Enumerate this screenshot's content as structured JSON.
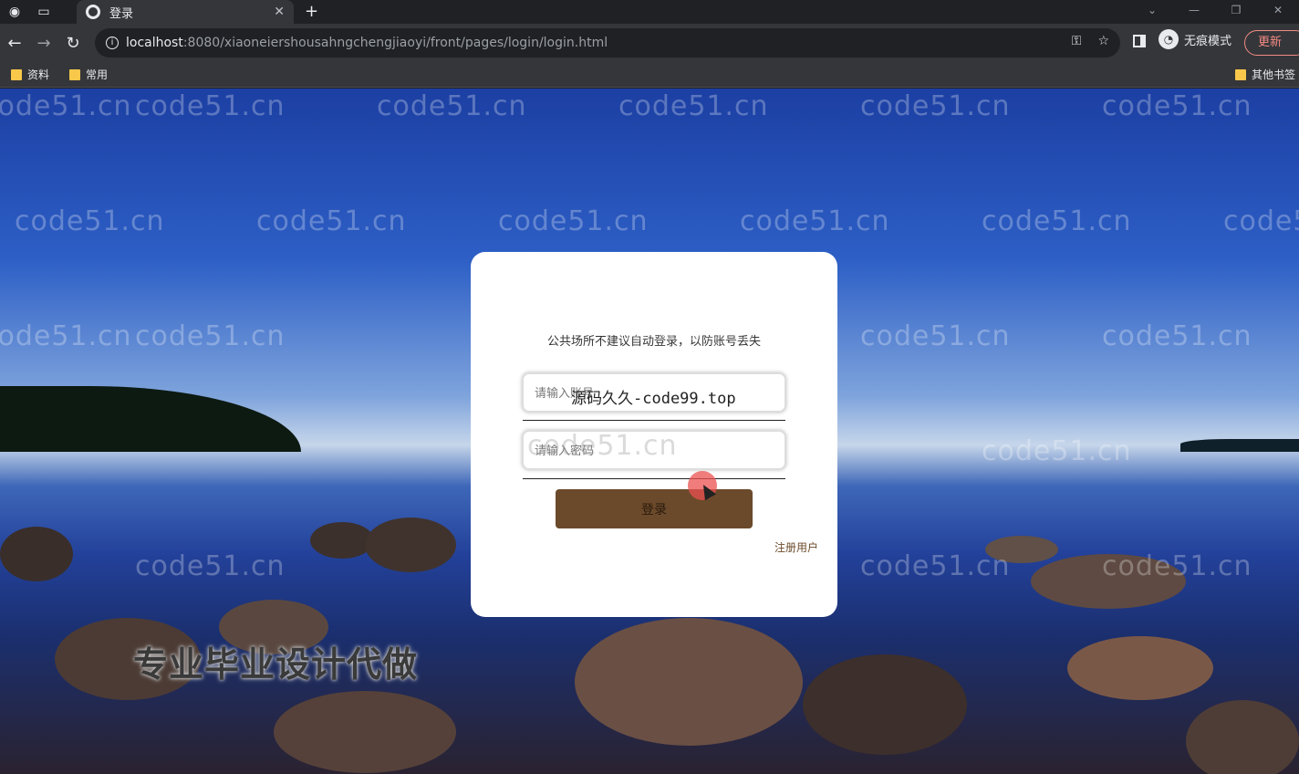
{
  "browser": {
    "tab_title": "登录",
    "tab_close": "✕",
    "new_tab": "+",
    "url_host": "localhost",
    "url_path": ":8080/xiaoneiershousahngchengjiaoyi/front/pages/login/login.html",
    "profile_label": "无痕模式",
    "update_label": "更新",
    "bookmarks": [
      "资料",
      "常用"
    ],
    "other_bookmarks": "其他书签"
  },
  "page": {
    "watermark_text": "code51.cn",
    "promo_text": "专业毕业设计代做"
  },
  "login": {
    "notice": "公共场所不建议自动登录，以防账号丢失",
    "username_placeholder": "请输入账号",
    "overlay_text": "源码久久-code99.top",
    "password_placeholder": "请输入密码",
    "login_button": "登录",
    "register_link": "注册用户"
  },
  "colors": {
    "button": "#6b4a2b",
    "card": "#ffffff"
  }
}
